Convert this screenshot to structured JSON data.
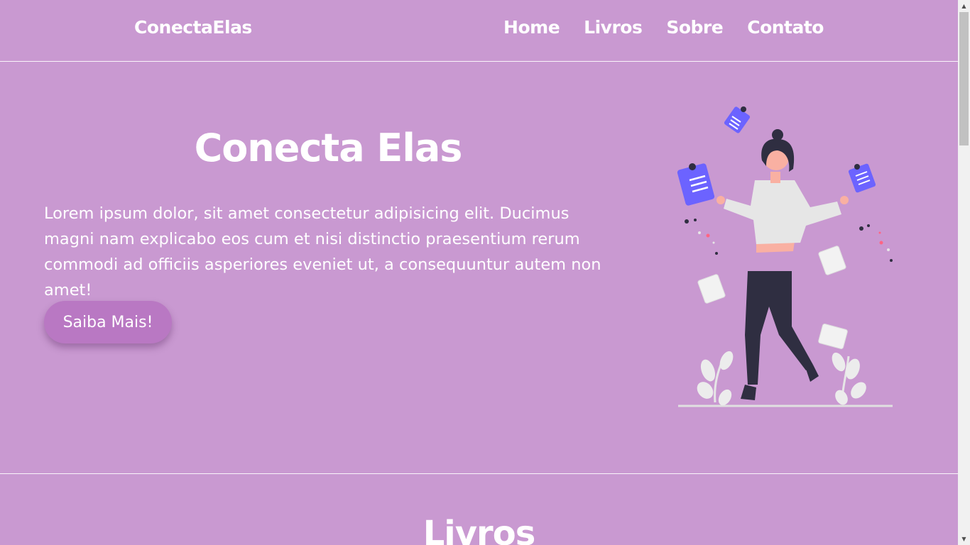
{
  "navbar": {
    "brand": "ConectaElas",
    "links": [
      "Home",
      "Livros",
      "Sobre",
      "Contato"
    ]
  },
  "hero": {
    "title": "Conecta Elas",
    "text": "Lorem ipsum dolor, sit amet consectetur adipisicing elit. Ducimus magni nam explicabo eos cum et nisi distinctio praesentium rerum commodi ad officiis asperiores eveniet ut, a consequuntur autem non amet!",
    "button_label": "Saiba Mais!",
    "illustration": "woman-juggling-notes-illustration"
  },
  "livros_section": {
    "title": "Livros"
  },
  "colors": {
    "background": "#c999d1",
    "button": "#b978c3",
    "accent_notes": "#6c63ff",
    "text": "#ffffff"
  },
  "scrollbar": {
    "up_icon": "scroll-up-arrow-icon",
    "down_icon": "scroll-down-arrow-icon"
  }
}
